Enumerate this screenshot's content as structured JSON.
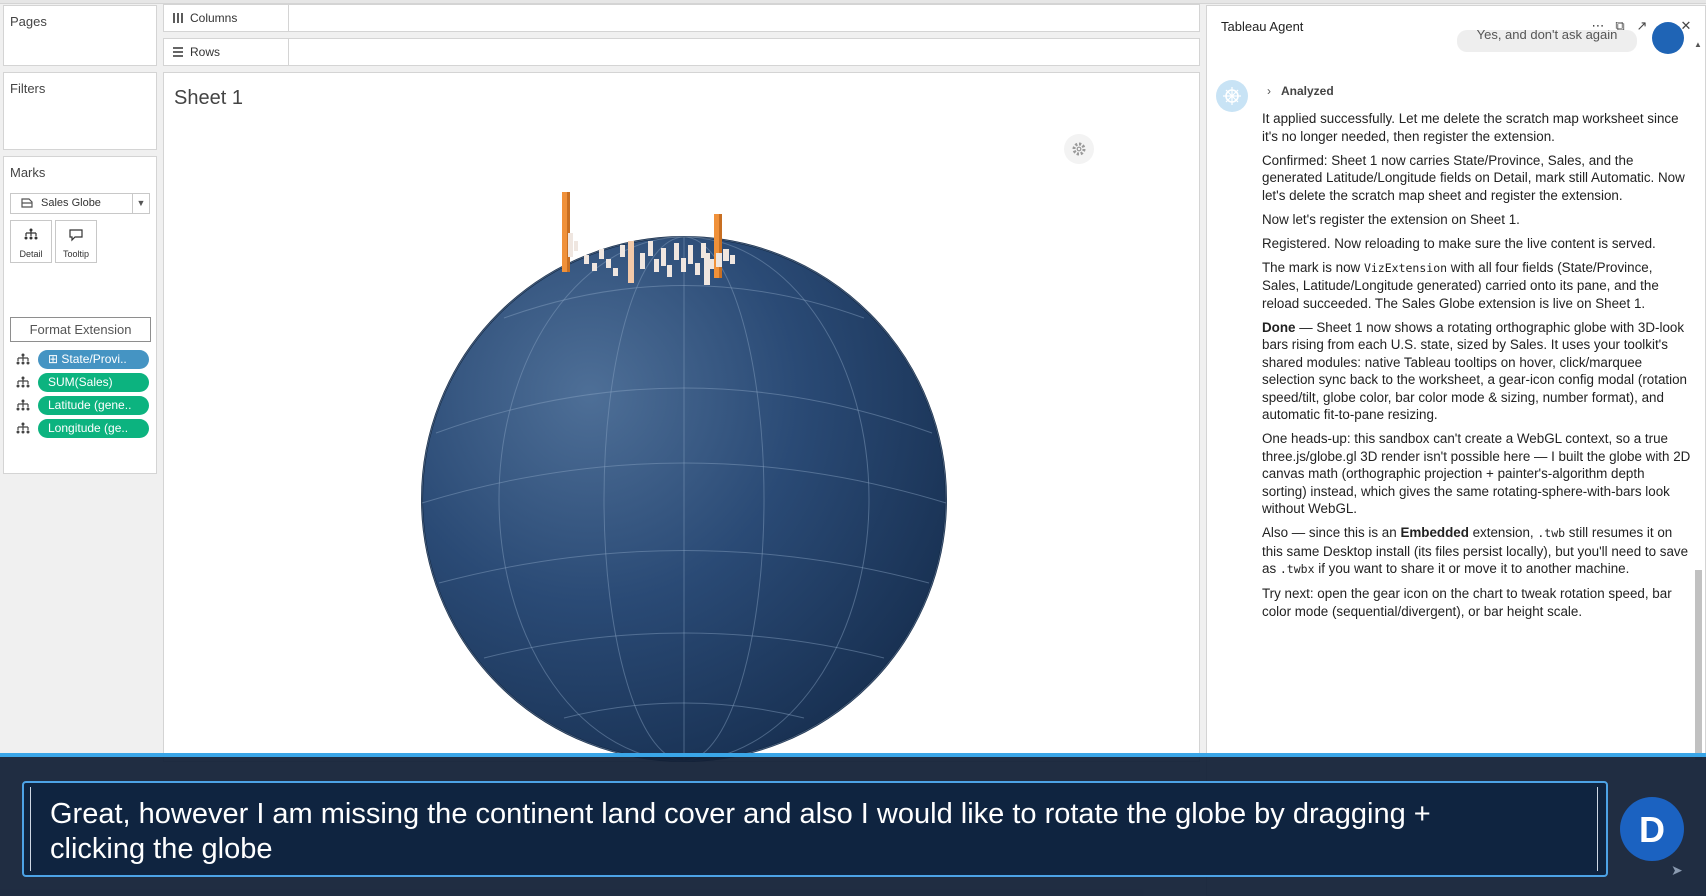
{
  "left_panel": {
    "pages_title": "Pages",
    "filters_title": "Filters",
    "marks_title": "Marks",
    "mark_type": "Sales Globe",
    "mark_buttons": {
      "detail": "Detail",
      "tooltip": "Tooltip"
    },
    "format_extension": "Format Extension",
    "fields": [
      {
        "label": "State/Provi..",
        "color": "#4594c3",
        "prefix": "⊞"
      },
      {
        "label": "SUM(Sales)",
        "color": "#0cb37f"
      },
      {
        "label": "Latitude (gene..",
        "color": "#0cb37f"
      },
      {
        "label": "Longitude (ge..",
        "color": "#0cb37f"
      }
    ]
  },
  "shelves": {
    "columns": "Columns",
    "rows": "Rows"
  },
  "sheet": {
    "title": "Sheet 1",
    "globe_color": "#1d3b64",
    "bar_color": "#f0913a",
    "bar_secondary_color": "#efe6e0"
  },
  "agent": {
    "title": "Tableau Agent",
    "user_message_partial": "Yes, and don't ask again",
    "status": "Analyzed",
    "p1": "It applied successfully. Let me delete the scratch map worksheet since it's no longer needed, then register the extension.",
    "p2": "Confirmed: Sheet 1 now carries State/Province, Sales, and the generated Latitude/Longitude fields on Detail, mark still Automatic. Now let's delete the scratch map sheet and register the extension.",
    "p3": "Now let's register the extension on Sheet 1.",
    "p4": "Registered. Now reloading to make sure the live content is served.",
    "p5_a": "The mark is now ",
    "p5_code": "VizExtension",
    "p5_b": " with all four fields (State/Province, Sales, Latitude/Longitude generated) carried onto its pane, and the reload succeeded. The Sales Globe extension is live on Sheet 1.",
    "p6_bold": "Done",
    "p6_rest": " — Sheet 1 now shows a rotating orthographic globe with 3D-look bars rising from each U.S. state, sized by Sales. It uses your toolkit's shared modules: native Tableau tooltips on hover, click/marquee selection sync back to the worksheet, a gear-icon config modal (rotation speed/tilt, globe color, bar color mode & sizing, number format), and automatic fit-to-pane resizing.",
    "p7": "One heads-up: this sandbox can't create a WebGL context, so a true three.js/globe.gl 3D render isn't possible here — I built the globe with 2D canvas math (orthographic projection + painter's-algorithm depth sorting) instead, which gives the same rotating-sphere-with-bars look without WebGL.",
    "p8_a": "Also — since this is an ",
    "p8_bold": "Embedded",
    "p8_b": " extension, ",
    "p8_code1": ".twb",
    "p8_c": " still resumes it on this same Desktop install (its files persist locally), but you'll need to save as ",
    "p8_code2": ".twbx",
    "p8_d": " if you want to share it or move it to another machine.",
    "p9": "Try next: open the gear icon on the chart to tweak rotation speed, bar color mode (sequential/divergent), or bar height scale."
  },
  "overlay": {
    "caption": "Great, however I am missing the continent land cover and also I would like to rotate the globe by dragging + clicking the globe",
    "avatar_initial": "D",
    "accent": "#3aa6e8"
  }
}
